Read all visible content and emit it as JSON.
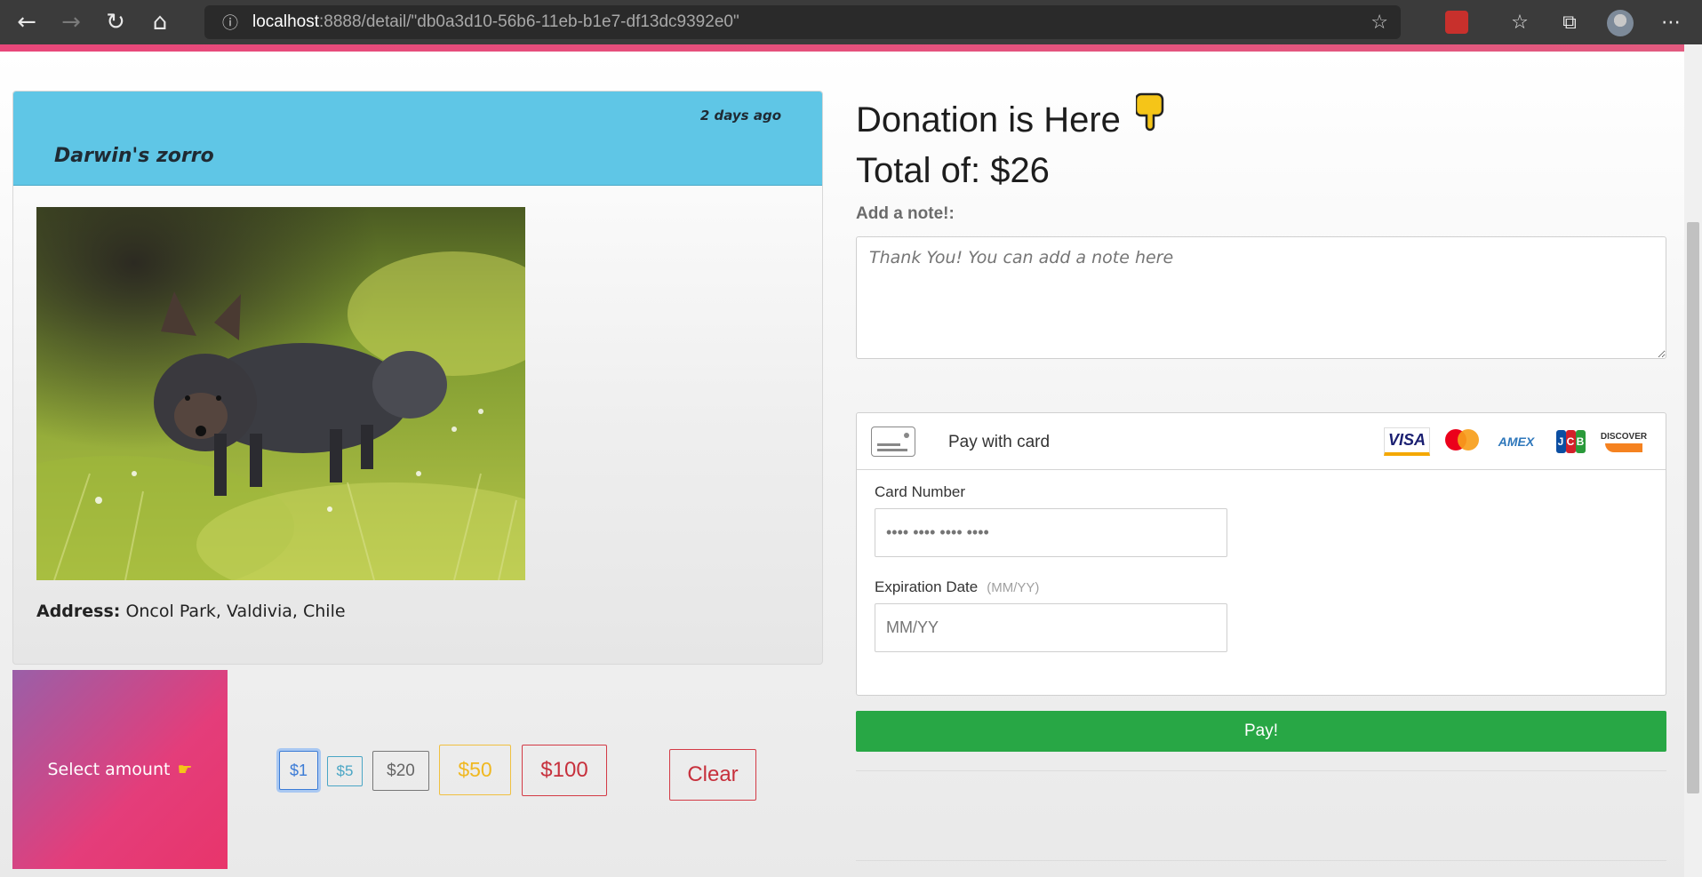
{
  "browser": {
    "url_host": "localhost",
    "url_rest": ":8888/detail/\"db0a3d10-56b6-11eb-b1e7-df13dc9392e0\"",
    "icons": [
      "back-icon",
      "forward-icon",
      "refresh-icon",
      "home-icon",
      "info-icon",
      "star-icon",
      "extension-icon",
      "favorites-icon",
      "collections-icon",
      "profile-avatar",
      "more-icon"
    ]
  },
  "post": {
    "time_ago": "2 days ago",
    "animal_name": "Darwin's zorro",
    "address_label": "Address:",
    "address_value": "Oncol Park, Valdivia, Chile"
  },
  "amounts": {
    "select_label": "Select amount",
    "options": [
      "$1",
      "$5",
      "$20",
      "$50",
      "$100"
    ],
    "selected": "$1",
    "clear_label": "Clear"
  },
  "donation": {
    "title": "Donation is Here",
    "total_label": "Total of: $26",
    "note_label": "Add a note!:",
    "note_placeholder": "Thank You! You can add a note here"
  },
  "payment": {
    "header": "Pay with card",
    "brands": [
      "VISA",
      "mastercard",
      "AMEX",
      "JCB",
      "DISCOVER"
    ],
    "card_number_label": "Card Number",
    "card_number_placeholder": "•••• •••• •••• ••••",
    "expiry_label": "Expiration Date",
    "expiry_hint": "(MM/YY)",
    "expiry_placeholder": "MM/YY",
    "pay_label": "Pay!"
  },
  "colors": {
    "accent": "#e8477a",
    "header_blue": "#5fc6e6",
    "pay_green": "#28a745",
    "danger": "#c7303c",
    "warning": "#f0b820",
    "info": "#4aa6c5",
    "primary": "#3b7bd6"
  }
}
